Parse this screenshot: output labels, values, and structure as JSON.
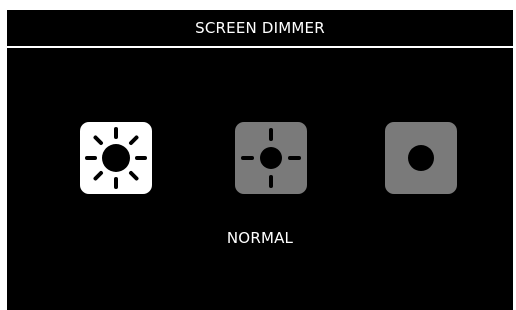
{
  "title": "SCREEN DIMMER",
  "current_mode_label": "NORMAL",
  "options": [
    {
      "icon": "bright-sun-icon",
      "state": "selected"
    },
    {
      "icon": "medium-sun-icon",
      "state": "unselected"
    },
    {
      "icon": "dim-circle-icon",
      "state": "unselected"
    }
  ],
  "colors": {
    "background": "#000000",
    "text": "#ffffff",
    "selected_tile": "#ffffff",
    "unselected_tile": "#7a7a7a",
    "glyph": "#000000"
  }
}
